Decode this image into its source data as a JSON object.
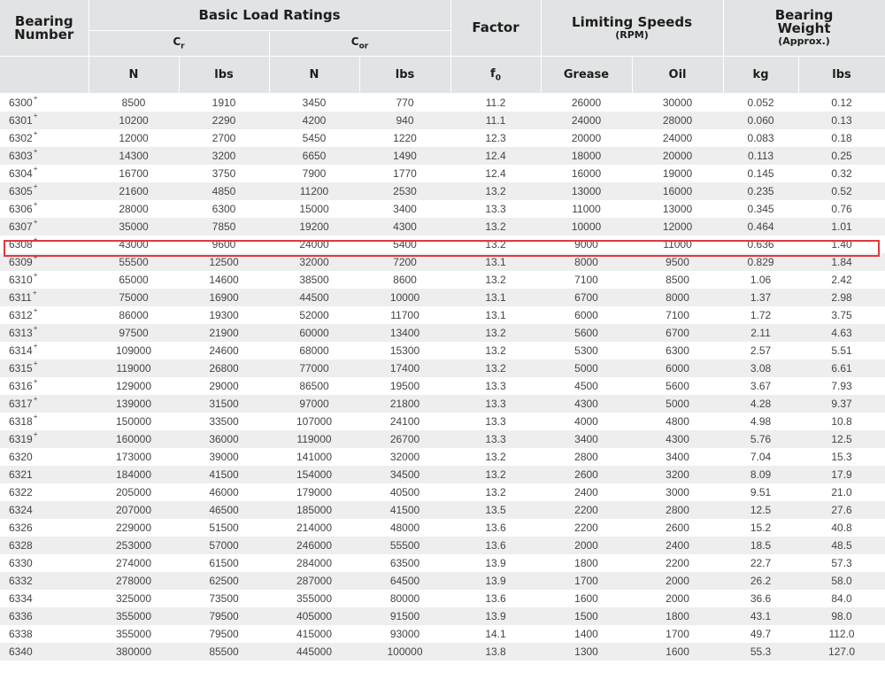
{
  "header": {
    "bearing_number": "Bearing Number",
    "basic_load_ratings": "Basic Load Ratings",
    "cr": "C",
    "cr_sub": "r",
    "cor": "C",
    "cor_sub": "or",
    "factor": "Factor",
    "limiting_speeds": "Limiting Speeds",
    "rpm": "(RPM)",
    "bearing_weight": "Bearing Weight",
    "approx": "(Approx.)",
    "units": {
      "cr_n": "N",
      "cr_lbs": "lbs",
      "cor_n": "N",
      "cor_lbs": "lbs",
      "f0": "f",
      "f0_sub": "0",
      "grease": "Grease",
      "oil": "Oil",
      "kg": "kg",
      "w_lbs": "lbs"
    }
  },
  "marker_symbol": "+",
  "highlighted_row": "6308",
  "highlight_color": "#e0393e",
  "rows": [
    {
      "bn": "6300",
      "mark": true,
      "cr_n": "8500",
      "cr_lbs": "1910",
      "cor_n": "3450",
      "cor_lbs": "770",
      "f0": "11.2",
      "grease": "26000",
      "oil": "30000",
      "kg": "0.052",
      "lbs": "0.12"
    },
    {
      "bn": "6301",
      "mark": true,
      "cr_n": "10200",
      "cr_lbs": "2290",
      "cor_n": "4200",
      "cor_lbs": "940",
      "f0": "11.1",
      "grease": "24000",
      "oil": "28000",
      "kg": "0.060",
      "lbs": "0.13"
    },
    {
      "bn": "6302",
      "mark": true,
      "cr_n": "12000",
      "cr_lbs": "2700",
      "cor_n": "5450",
      "cor_lbs": "1220",
      "f0": "12.3",
      "grease": "20000",
      "oil": "24000",
      "kg": "0.083",
      "lbs": "0.18"
    },
    {
      "bn": "6303",
      "mark": true,
      "cr_n": "14300",
      "cr_lbs": "3200",
      "cor_n": "6650",
      "cor_lbs": "1490",
      "f0": "12.4",
      "grease": "18000",
      "oil": "20000",
      "kg": "0.113",
      "lbs": "0.25"
    },
    {
      "bn": "6304",
      "mark": true,
      "cr_n": "16700",
      "cr_lbs": "3750",
      "cor_n": "7900",
      "cor_lbs": "1770",
      "f0": "12.4",
      "grease": "16000",
      "oil": "19000",
      "kg": "0.145",
      "lbs": "0.32"
    },
    {
      "bn": "6305",
      "mark": true,
      "cr_n": "21600",
      "cr_lbs": "4850",
      "cor_n": "11200",
      "cor_lbs": "2530",
      "f0": "13.2",
      "grease": "13000",
      "oil": "16000",
      "kg": "0.235",
      "lbs": "0.52"
    },
    {
      "bn": "6306",
      "mark": true,
      "cr_n": "28000",
      "cr_lbs": "6300",
      "cor_n": "15000",
      "cor_lbs": "3400",
      "f0": "13.3",
      "grease": "11000",
      "oil": "13000",
      "kg": "0.345",
      "lbs": "0.76"
    },
    {
      "bn": "6307",
      "mark": true,
      "cr_n": "35000",
      "cr_lbs": "7850",
      "cor_n": "19200",
      "cor_lbs": "4300",
      "f0": "13.2",
      "grease": "10000",
      "oil": "12000",
      "kg": "0.464",
      "lbs": "1.01"
    },
    {
      "bn": "6308",
      "mark": true,
      "cr_n": "43000",
      "cr_lbs": "9600",
      "cor_n": "24000",
      "cor_lbs": "5400",
      "f0": "13.2",
      "grease": "9000",
      "oil": "11000",
      "kg": "0.636",
      "lbs": "1.40"
    },
    {
      "bn": "6309",
      "mark": true,
      "cr_n": "55500",
      "cr_lbs": "12500",
      "cor_n": "32000",
      "cor_lbs": "7200",
      "f0": "13.1",
      "grease": "8000",
      "oil": "9500",
      "kg": "0.829",
      "lbs": "1.84"
    },
    {
      "bn": "6310",
      "mark": true,
      "cr_n": "65000",
      "cr_lbs": "14600",
      "cor_n": "38500",
      "cor_lbs": "8600",
      "f0": "13.2",
      "grease": "7100",
      "oil": "8500",
      "kg": "1.06",
      "lbs": "2.42"
    },
    {
      "bn": "6311",
      "mark": true,
      "cr_n": "75000",
      "cr_lbs": "16900",
      "cor_n": "44500",
      "cor_lbs": "10000",
      "f0": "13.1",
      "grease": "6700",
      "oil": "8000",
      "kg": "1.37",
      "lbs": "2.98"
    },
    {
      "bn": "6312",
      "mark": true,
      "cr_n": "86000",
      "cr_lbs": "19300",
      "cor_n": "52000",
      "cor_lbs": "11700",
      "f0": "13.1",
      "grease": "6000",
      "oil": "7100",
      "kg": "1.72",
      "lbs": "3.75"
    },
    {
      "bn": "6313",
      "mark": true,
      "cr_n": "97500",
      "cr_lbs": "21900",
      "cor_n": "60000",
      "cor_lbs": "13400",
      "f0": "13.2",
      "grease": "5600",
      "oil": "6700",
      "kg": "2.11",
      "lbs": "4.63"
    },
    {
      "bn": "6314",
      "mark": true,
      "cr_n": "109000",
      "cr_lbs": "24600",
      "cor_n": "68000",
      "cor_lbs": "15300",
      "f0": "13.2",
      "grease": "5300",
      "oil": "6300",
      "kg": "2.57",
      "lbs": "5.51"
    },
    {
      "bn": "6315",
      "mark": true,
      "cr_n": "119000",
      "cr_lbs": "26800",
      "cor_n": "77000",
      "cor_lbs": "17400",
      "f0": "13.2",
      "grease": "5000",
      "oil": "6000",
      "kg": "3.08",
      "lbs": "6.61"
    },
    {
      "bn": "6316",
      "mark": true,
      "cr_n": "129000",
      "cr_lbs": "29000",
      "cor_n": "86500",
      "cor_lbs": "19500",
      "f0": "13.3",
      "grease": "4500",
      "oil": "5600",
      "kg": "3.67",
      "lbs": "7.93"
    },
    {
      "bn": "6317",
      "mark": true,
      "cr_n": "139000",
      "cr_lbs": "31500",
      "cor_n": "97000",
      "cor_lbs": "21800",
      "f0": "13.3",
      "grease": "4300",
      "oil": "5000",
      "kg": "4.28",
      "lbs": "9.37"
    },
    {
      "bn": "6318",
      "mark": true,
      "cr_n": "150000",
      "cr_lbs": "33500",
      "cor_n": "107000",
      "cor_lbs": "24100",
      "f0": "13.3",
      "grease": "4000",
      "oil": "4800",
      "kg": "4.98",
      "lbs": "10.8"
    },
    {
      "bn": "6319",
      "mark": true,
      "cr_n": "160000",
      "cr_lbs": "36000",
      "cor_n": "119000",
      "cor_lbs": "26700",
      "f0": "13.3",
      "grease": "3400",
      "oil": "4300",
      "kg": "5.76",
      "lbs": "12.5"
    },
    {
      "bn": "6320",
      "mark": false,
      "cr_n": "173000",
      "cr_lbs": "39000",
      "cor_n": "141000",
      "cor_lbs": "32000",
      "f0": "13.2",
      "grease": "2800",
      "oil": "3400",
      "kg": "7.04",
      "lbs": "15.3"
    },
    {
      "bn": "6321",
      "mark": false,
      "cr_n": "184000",
      "cr_lbs": "41500",
      "cor_n": "154000",
      "cor_lbs": "34500",
      "f0": "13.2",
      "grease": "2600",
      "oil": "3200",
      "kg": "8.09",
      "lbs": "17.9"
    },
    {
      "bn": "6322",
      "mark": false,
      "cr_n": "205000",
      "cr_lbs": "46000",
      "cor_n": "179000",
      "cor_lbs": "40500",
      "f0": "13.2",
      "grease": "2400",
      "oil": "3000",
      "kg": "9.51",
      "lbs": "21.0"
    },
    {
      "bn": "6324",
      "mark": false,
      "cr_n": "207000",
      "cr_lbs": "46500",
      "cor_n": "185000",
      "cor_lbs": "41500",
      "f0": "13.5",
      "grease": "2200",
      "oil": "2800",
      "kg": "12.5",
      "lbs": "27.6"
    },
    {
      "bn": "6326",
      "mark": false,
      "cr_n": "229000",
      "cr_lbs": "51500",
      "cor_n": "214000",
      "cor_lbs": "48000",
      "f0": "13.6",
      "grease": "2200",
      "oil": "2600",
      "kg": "15.2",
      "lbs": "40.8"
    },
    {
      "bn": "6328",
      "mark": false,
      "cr_n": "253000",
      "cr_lbs": "57000",
      "cor_n": "246000",
      "cor_lbs": "55500",
      "f0": "13.6",
      "grease": "2000",
      "oil": "2400",
      "kg": "18.5",
      "lbs": "48.5"
    },
    {
      "bn": "6330",
      "mark": false,
      "cr_n": "274000",
      "cr_lbs": "61500",
      "cor_n": "284000",
      "cor_lbs": "63500",
      "f0": "13.9",
      "grease": "1800",
      "oil": "2200",
      "kg": "22.7",
      "lbs": "57.3"
    },
    {
      "bn": "6332",
      "mark": false,
      "cr_n": "278000",
      "cr_lbs": "62500",
      "cor_n": "287000",
      "cor_lbs": "64500",
      "f0": "13.9",
      "grease": "1700",
      "oil": "2000",
      "kg": "26.2",
      "lbs": "58.0"
    },
    {
      "bn": "6334",
      "mark": false,
      "cr_n": "325000",
      "cr_lbs": "73500",
      "cor_n": "355000",
      "cor_lbs": "80000",
      "f0": "13.6",
      "grease": "1600",
      "oil": "2000",
      "kg": "36.6",
      "lbs": "84.0"
    },
    {
      "bn": "6336",
      "mark": false,
      "cr_n": "355000",
      "cr_lbs": "79500",
      "cor_n": "405000",
      "cor_lbs": "91500",
      "f0": "13.9",
      "grease": "1500",
      "oil": "1800",
      "kg": "43.1",
      "lbs": "98.0"
    },
    {
      "bn": "6338",
      "mark": false,
      "cr_n": "355000",
      "cr_lbs": "79500",
      "cor_n": "415000",
      "cor_lbs": "93000",
      "f0": "14.1",
      "grease": "1400",
      "oil": "1700",
      "kg": "49.7",
      "lbs": "112.0"
    },
    {
      "bn": "6340",
      "mark": false,
      "cr_n": "380000",
      "cr_lbs": "85500",
      "cor_n": "445000",
      "cor_lbs": "100000",
      "f0": "13.8",
      "grease": "1300",
      "oil": "1600",
      "kg": "55.3",
      "lbs": "127.0"
    }
  ]
}
